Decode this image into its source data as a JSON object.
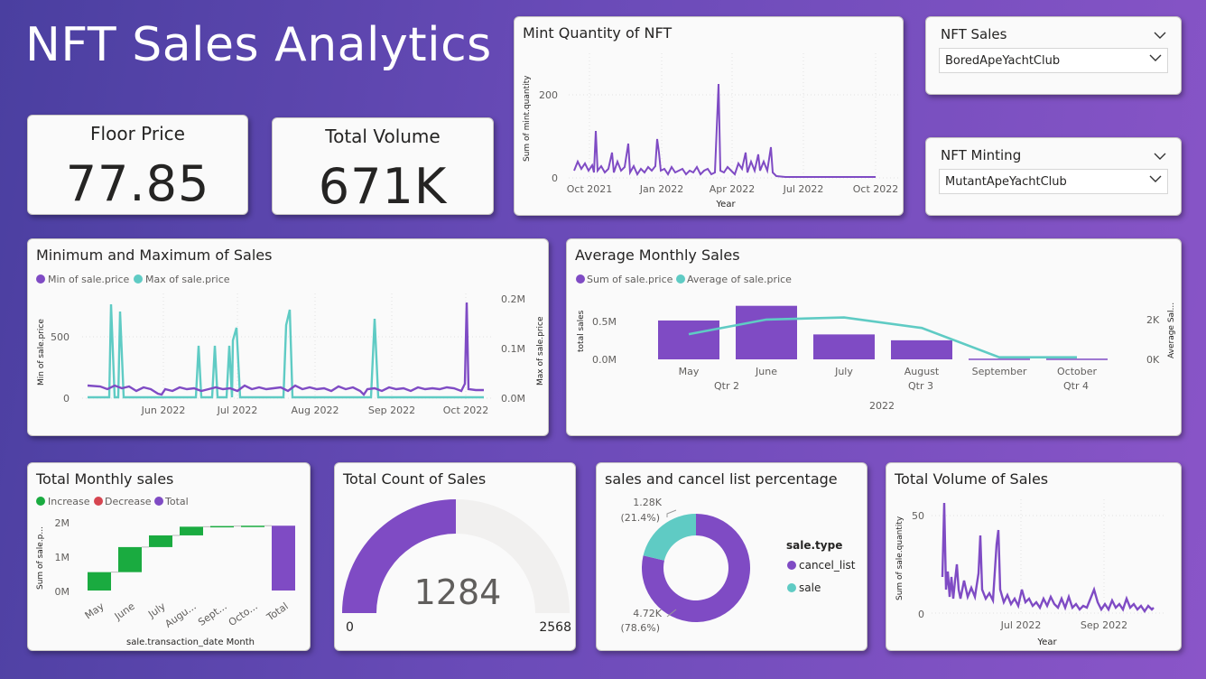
{
  "title": "NFT Sales Analytics",
  "kpis": {
    "floor": {
      "label": "Floor Price",
      "value": "77.85"
    },
    "volume": {
      "label": "Total Volume",
      "value": "671K"
    }
  },
  "slicers": {
    "sales": {
      "label": "NFT Sales",
      "value": "BoredApeYachtClub"
    },
    "minting": {
      "label": "NFT Minting",
      "value": "MutantApeYachtClub"
    }
  },
  "colors": {
    "purple": "#7f4bc4",
    "teal": "#5fcbc4",
    "green": "#1aab40",
    "red": "#d64550",
    "grey": "#f1f0ef"
  },
  "mint_chart": {
    "title": "Mint Quantity of NFT",
    "ylabel": "Sum of mint.quantity",
    "xlabel": "Year",
    "yticks": [
      "0",
      "200"
    ],
    "xticks": [
      "Oct 2021",
      "Jan 2022",
      "Apr 2022",
      "Jul 2022",
      "Oct 2022"
    ]
  },
  "minmax_chart": {
    "title": "Minimum and Maximum of Sales",
    "legend": [
      "Min of sale.price",
      "Max of sale.price"
    ],
    "ylabel_left": "Min of sale.price",
    "ylabel_right": "Max of sale.price",
    "yticks_left": [
      "0",
      "500"
    ],
    "yticks_right": [
      "0.0M",
      "0.1M",
      "0.2M"
    ],
    "xticks": [
      "Jun 2022",
      "Jul 2022",
      "Aug 2022",
      "Sep 2022",
      "Oct 2022"
    ]
  },
  "avg_chart": {
    "title": "Average Monthly Sales",
    "legend": [
      "Sum of sale.price",
      "Average of sale.price"
    ],
    "ylabel_left": "total sales",
    "ylabel_right": "Average Sal...",
    "yticks_left": [
      "0.0M",
      "0.5M"
    ],
    "yticks_right": [
      "0K",
      "2K"
    ],
    "quarters": [
      "Qtr 2",
      "Qtr 3",
      "Qtr 4"
    ],
    "year": "2022"
  },
  "waterfall_chart": {
    "title": "Total Monthly sales",
    "legend": [
      "Increase",
      "Decrease",
      "Total"
    ],
    "ylabel": "Sum of sale.p...",
    "xlabel": "sale.transaction_date Month",
    "yticks": [
      "0M",
      "1M",
      "2M"
    ]
  },
  "gauge_chart": {
    "title": "Total Count of Sales",
    "value": "1284",
    "min": "0",
    "max": "2568"
  },
  "donut_chart": {
    "title": "sales and cancel list percentage",
    "legend_title": "sale.type",
    "label_sale": "1.28K",
    "label_sale_pct": "(21.4%)",
    "label_cancel": "4.72K",
    "label_cancel_pct": "(78.6%)"
  },
  "volume_chart": {
    "title": "Total Volume of Sales",
    "ylabel": "Sum of sale.quantity",
    "xlabel": "Year",
    "yticks": [
      "0",
      "50"
    ],
    "xticks": [
      "Jul 2022",
      "Sep 2022"
    ]
  },
  "chart_data": [
    {
      "type": "line",
      "title": "Mint Quantity of NFT",
      "xlabel": "Year",
      "ylabel": "Sum of mint.quantity",
      "x": [
        "2021-09-15",
        "2021-10-01",
        "2021-10-15",
        "2021-11-01",
        "2021-11-15",
        "2021-12-01",
        "2021-12-15",
        "2022-01-01",
        "2022-01-15",
        "2022-02-01",
        "2022-02-15",
        "2022-03-01",
        "2022-03-15",
        "2022-04-01",
        "2022-04-15",
        "2022-05-01",
        "2022-05-15",
        "2022-06-01",
        "2022-07-01",
        "2022-08-01",
        "2022-09-01",
        "2022-10-01",
        "2022-10-20"
      ],
      "series": [
        {
          "name": "",
          "values": [
            25,
            30,
            110,
            20,
            70,
            15,
            50,
            18,
            95,
            20,
            30,
            15,
            20,
            230,
            20,
            50,
            30,
            80,
            3,
            2,
            2,
            2,
            2
          ]
        }
      ],
      "ylim": [
        0,
        240
      ]
    },
    {
      "type": "line",
      "title": "Minimum and Maximum of Sales",
      "x": [
        "2022-05-01",
        "2022-05-10",
        "2022-05-20",
        "2022-06-01",
        "2022-06-10",
        "2022-06-20",
        "2022-07-01",
        "2022-07-10",
        "2022-07-20",
        "2022-08-01",
        "2022-08-10",
        "2022-08-20",
        "2022-09-01",
        "2022-09-10",
        "2022-09-20",
        "2022-10-01",
        "2022-10-10"
      ],
      "series": [
        {
          "name": "Min of sale.price",
          "axis": "left",
          "values": [
            100,
            80,
            70,
            60,
            70,
            80,
            75,
            60,
            65,
            60,
            60,
            50,
            40,
            70,
            60,
            780,
            60
          ]
        },
        {
          "name": "Max of sale.price",
          "axis": "right",
          "values": [
            0,
            190000,
            0,
            0,
            100000,
            105000,
            100000,
            0,
            180000,
            0,
            0,
            0,
            165000,
            0,
            0,
            0,
            0
          ]
        }
      ],
      "ylim_left": [
        0,
        800
      ],
      "ylim_right": [
        0,
        200000
      ]
    },
    {
      "type": "bar",
      "title": "Average Monthly Sales",
      "categories": [
        "May",
        "June",
        "July",
        "August",
        "September",
        "October"
      ],
      "series": [
        {
          "name": "Sum of sale.price",
          "axis": "left",
          "values": [
            0.53,
            0.73,
            0.34,
            0.26,
            0.01,
            0.01
          ]
        },
        {
          "name": "Average of sale.price",
          "axis": "right",
          "values": [
            1200,
            1900,
            2000,
            1500,
            100,
            100
          ]
        }
      ],
      "ylim_left": [
        0,
        0.8
      ],
      "ylim_right": [
        0,
        2800
      ]
    },
    {
      "type": "bar",
      "title": "Total Monthly sales",
      "categories": [
        "May",
        "June",
        "July",
        "Augu...",
        "Sept...",
        "Octo...",
        "Total"
      ],
      "values": [
        0.55,
        0.75,
        0.35,
        0.26,
        0.02,
        0.01,
        1.94
      ],
      "ylim": [
        0,
        2.2
      ]
    },
    {
      "type": "pie",
      "title": "sales and cancel list percentage",
      "categories": [
        "cancel_list",
        "sale"
      ],
      "values": [
        4720,
        1280
      ]
    },
    {
      "type": "line",
      "title": "Total Volume of Sales",
      "xlabel": "Year",
      "ylabel": "Sum of sale.quantity",
      "x": [
        "2022-05-01",
        "2022-05-10",
        "2022-05-20",
        "2022-06-01",
        "2022-06-10",
        "2022-06-20",
        "2022-07-01",
        "2022-07-10",
        "2022-07-20",
        "2022-08-01",
        "2022-08-10",
        "2022-08-20",
        "2022-09-01",
        "2022-09-10",
        "2022-09-20",
        "2022-10-01",
        "2022-10-15"
      ],
      "series": [
        {
          "name": "",
          "values": [
            22,
            12,
            25,
            10,
            40,
            9,
            10,
            8,
            12,
            7,
            5,
            10,
            5,
            3,
            7,
            4,
            3
          ]
        }
      ],
      "ylim": [
        0,
        58
      ]
    }
  ]
}
